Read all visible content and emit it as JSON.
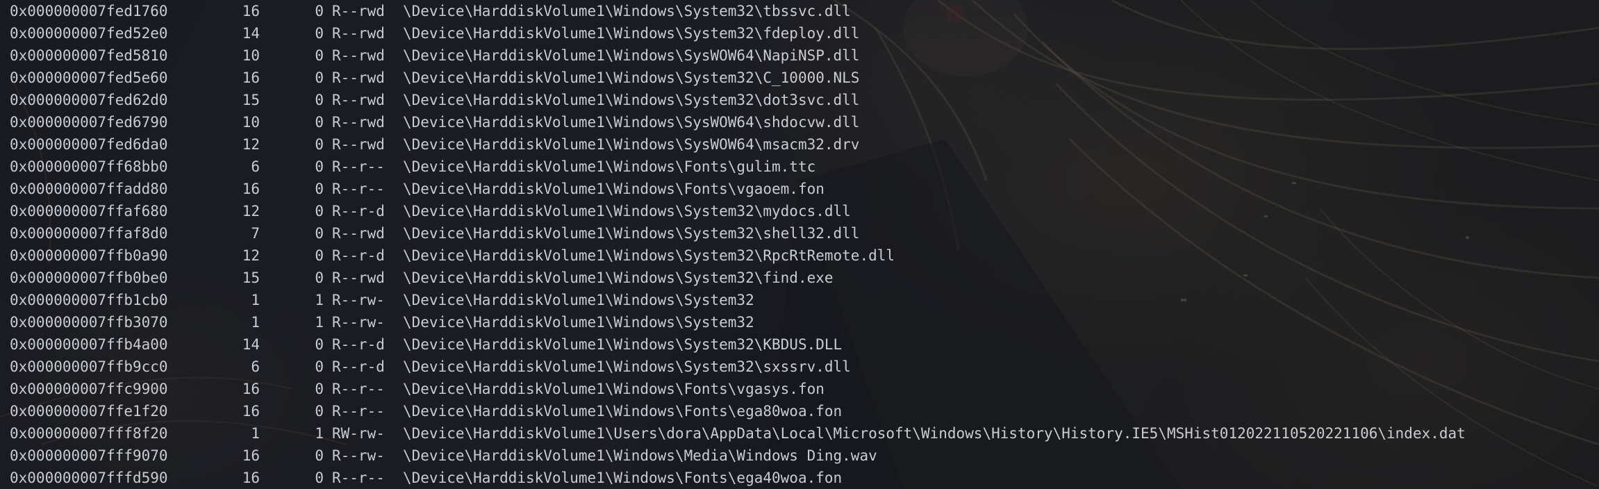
{
  "terminal": {
    "lines": [
      {
        "offset": "0x000000007fed1760",
        "pointers": "16",
        "handles": "0",
        "access": "R--rwd",
        "path": "\\Device\\HarddiskVolume1\\Windows\\System32\\tbssvc.dll"
      },
      {
        "offset": "0x000000007fed52e0",
        "pointers": "14",
        "handles": "0",
        "access": "R--rwd",
        "path": "\\Device\\HarddiskVolume1\\Windows\\System32\\fdeploy.dll"
      },
      {
        "offset": "0x000000007fed5810",
        "pointers": "10",
        "handles": "0",
        "access": "R--rwd",
        "path": "\\Device\\HarddiskVolume1\\Windows\\SysWOW64\\NapiNSP.dll"
      },
      {
        "offset": "0x000000007fed5e60",
        "pointers": "16",
        "handles": "0",
        "access": "R--rwd",
        "path": "\\Device\\HarddiskVolume1\\Windows\\System32\\C_10000.NLS"
      },
      {
        "offset": "0x000000007fed62d0",
        "pointers": "15",
        "handles": "0",
        "access": "R--rwd",
        "path": "\\Device\\HarddiskVolume1\\Windows\\System32\\dot3svc.dll"
      },
      {
        "offset": "0x000000007fed6790",
        "pointers": "10",
        "handles": "0",
        "access": "R--rwd",
        "path": "\\Device\\HarddiskVolume1\\Windows\\SysWOW64\\shdocvw.dll"
      },
      {
        "offset": "0x000000007fed6da0",
        "pointers": "12",
        "handles": "0",
        "access": "R--rwd",
        "path": "\\Device\\HarddiskVolume1\\Windows\\SysWOW64\\msacm32.drv"
      },
      {
        "offset": "0x000000007ff68bb0",
        "pointers": "6",
        "handles": "0",
        "access": "R--r--",
        "path": "\\Device\\HarddiskVolume1\\Windows\\Fonts\\gulim.ttc"
      },
      {
        "offset": "0x000000007ffadd80",
        "pointers": "16",
        "handles": "0",
        "access": "R--r--",
        "path": "\\Device\\HarddiskVolume1\\Windows\\Fonts\\vgaoem.fon"
      },
      {
        "offset": "0x000000007ffaf680",
        "pointers": "12",
        "handles": "0",
        "access": "R--r-d",
        "path": "\\Device\\HarddiskVolume1\\Windows\\System32\\mydocs.dll"
      },
      {
        "offset": "0x000000007ffaf8d0",
        "pointers": "7",
        "handles": "0",
        "access": "R--rwd",
        "path": "\\Device\\HarddiskVolume1\\Windows\\System32\\shell32.dll"
      },
      {
        "offset": "0x000000007ffb0a90",
        "pointers": "12",
        "handles": "0",
        "access": "R--r-d",
        "path": "\\Device\\HarddiskVolume1\\Windows\\System32\\RpcRtRemote.dll"
      },
      {
        "offset": "0x000000007ffb0be0",
        "pointers": "15",
        "handles": "0",
        "access": "R--rwd",
        "path": "\\Device\\HarddiskVolume1\\Windows\\System32\\find.exe"
      },
      {
        "offset": "0x000000007ffb1cb0",
        "pointers": "1",
        "handles": "1",
        "access": "R--rw-",
        "path": "\\Device\\HarddiskVolume1\\Windows\\System32"
      },
      {
        "offset": "0x000000007ffb3070",
        "pointers": "1",
        "handles": "1",
        "access": "R--rw-",
        "path": "\\Device\\HarddiskVolume1\\Windows\\System32"
      },
      {
        "offset": "0x000000007ffb4a00",
        "pointers": "14",
        "handles": "0",
        "access": "R--r-d",
        "path": "\\Device\\HarddiskVolume1\\Windows\\System32\\KBDUS.DLL"
      },
      {
        "offset": "0x000000007ffb9cc0",
        "pointers": "6",
        "handles": "0",
        "access": "R--r-d",
        "path": "\\Device\\HarddiskVolume1\\Windows\\System32\\sxssrv.dll"
      },
      {
        "offset": "0x000000007ffc9900",
        "pointers": "16",
        "handles": "0",
        "access": "R--r--",
        "path": "\\Device\\HarddiskVolume1\\Windows\\Fonts\\vgasys.fon"
      },
      {
        "offset": "0x000000007ffe1f20",
        "pointers": "16",
        "handles": "0",
        "access": "R--r--",
        "path": "\\Device\\HarddiskVolume1\\Windows\\Fonts\\ega80woa.fon"
      },
      {
        "offset": "0x000000007fff8f20",
        "pointers": "1",
        "handles": "1",
        "access": "RW-rw-",
        "path": "\\Device\\HarddiskVolume1\\Users\\dora\\AppData\\Local\\Microsoft\\Windows\\History\\History.IE5\\MSHist012022110520221106\\index.dat"
      },
      {
        "offset": "0x000000007fff9070",
        "pointers": "16",
        "handles": "0",
        "access": "R--rw-",
        "path": "\\Device\\HarddiskVolume1\\Windows\\Media\\Windows Ding.wav"
      },
      {
        "offset": "0x000000007fffd590",
        "pointers": "16",
        "handles": "0",
        "access": "R--r--",
        "path": "\\Device\\HarddiskVolume1\\Windows\\Fonts\\ega40woa.fon"
      }
    ]
  },
  "colors": {
    "text": "#c9ccd2",
    "background": "#22242a"
  }
}
